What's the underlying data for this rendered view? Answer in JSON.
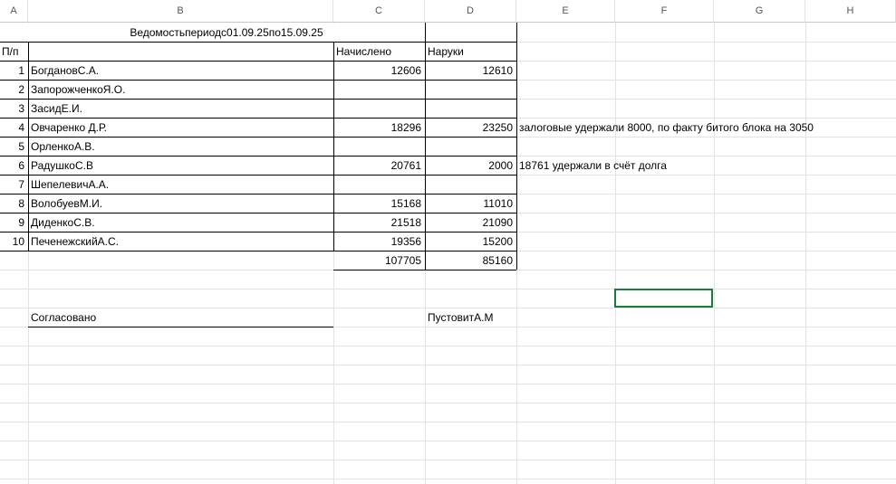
{
  "columns": [
    "A",
    "B",
    "C",
    "D",
    "E",
    "F",
    "G",
    "H"
  ],
  "title": "Ведомостьпериодс01.09.25по15.09.25",
  "headers": {
    "num": "П/п",
    "accrued": "Начислено",
    "cash": "Наруки"
  },
  "rows": [
    {
      "num": "1",
      "name": "БогдановС.А.",
      "accrued": "12606",
      "cash": "12610",
      "note": ""
    },
    {
      "num": "2",
      "name": "ЗапорожченкоЯ.О.",
      "accrued": "",
      "cash": "",
      "note": ""
    },
    {
      "num": "3",
      "name": "ЗасидЕ.И.",
      "accrued": "",
      "cash": "",
      "note": ""
    },
    {
      "num": "4",
      "name": "Овчаренко Д.Р.",
      "accrued": "18296",
      "cash": "23250",
      "note": "залоговые удержали 8000, по факту битого блока на 3050"
    },
    {
      "num": "5",
      "name": "ОрленкоА.В.",
      "accrued": "",
      "cash": "",
      "note": ""
    },
    {
      "num": "6",
      "name": "РадушкоС.В",
      "accrued": "20761",
      "cash": "2000",
      "note": "18761 удержали в счёт долга"
    },
    {
      "num": "7",
      "name": "ШепелевичА.А.",
      "accrued": "",
      "cash": "",
      "note": ""
    },
    {
      "num": "8",
      "name": "ВолобуевМ.И.",
      "accrued": "15168",
      "cash": "11010",
      "note": ""
    },
    {
      "num": "9",
      "name": "ДиденкоС.В.",
      "accrued": "21518",
      "cash": "21090",
      "note": ""
    },
    {
      "num": "10",
      "name": "ПеченежскийА.С.",
      "accrued": "19356",
      "cash": "15200",
      "note": ""
    }
  ],
  "totals": {
    "accrued": "107705",
    "cash": "85160"
  },
  "footer": {
    "approved_label": "Согласовано",
    "signer": "ПустовитА.М"
  },
  "colors": {
    "grid": "#e2e3e3",
    "selection": "#1a7c3c"
  }
}
